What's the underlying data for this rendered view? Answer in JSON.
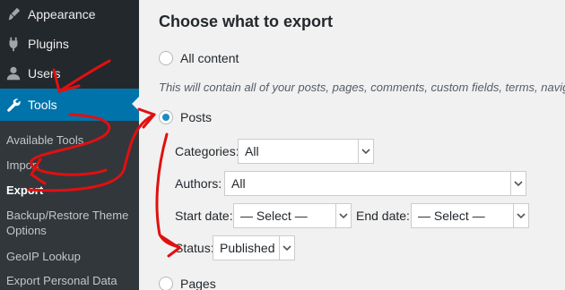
{
  "sidebar": {
    "menu": [
      {
        "label": "Appearance",
        "icon": "paintbrush-icon"
      },
      {
        "label": "Plugins",
        "icon": "plugin-icon"
      },
      {
        "label": "Users",
        "icon": "user-icon"
      },
      {
        "label": "Tools",
        "icon": "wrench-icon",
        "active": true
      }
    ],
    "submenu": [
      {
        "label": "Available Tools"
      },
      {
        "label": "Import"
      },
      {
        "label": "Export",
        "current": true
      },
      {
        "label": "Backup/Restore Theme Options"
      },
      {
        "label": "GeoIP Lookup"
      },
      {
        "label": "Export Personal Data"
      }
    ],
    "colors": {
      "background": "#23282d",
      "submenu": "#32373c",
      "active": "#0073aa"
    }
  },
  "main": {
    "title": "Choose what to export",
    "options": {
      "all_content": "All content",
      "description": "This will contain all of your posts, pages, comments, custom fields, terms, navigati",
      "posts": "Posts",
      "pages": "Pages"
    },
    "filters": {
      "categories_label": "Categories:",
      "categories_value": "All",
      "authors_label": "Authors:",
      "authors_value": "All",
      "start_date_label": "Start date:",
      "start_date_value": "— Select —",
      "end_date_label": "End date:",
      "end_date_value": "— Select —",
      "status_label": "Status:",
      "status_value": "Published"
    },
    "selected_option": "Posts"
  },
  "annotation": {
    "color": "#e01010"
  }
}
